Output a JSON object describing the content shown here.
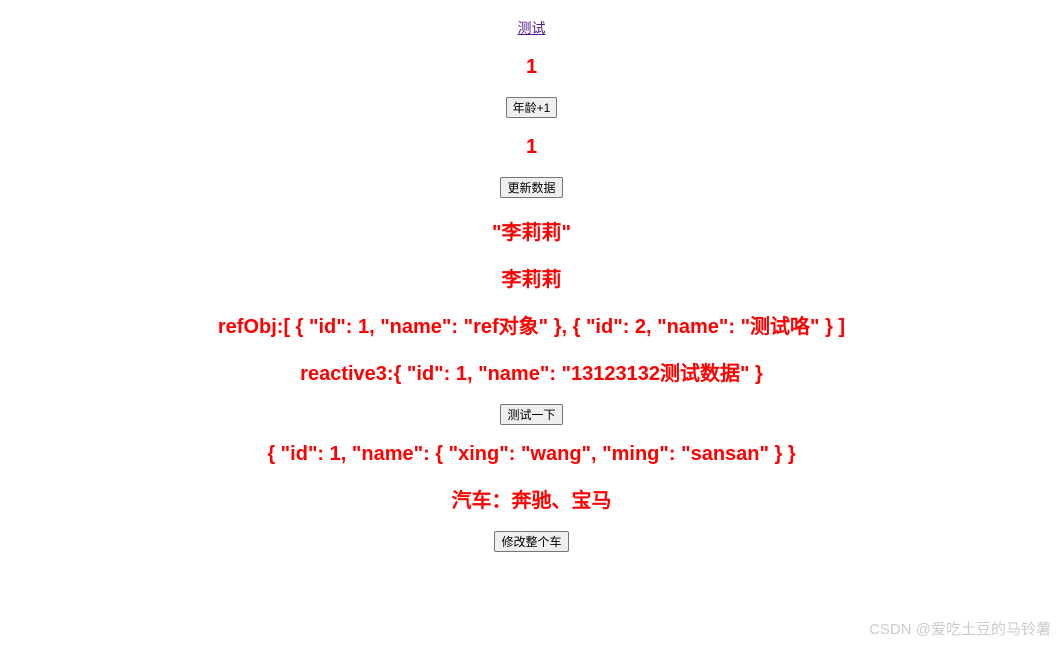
{
  "link": {
    "label": "测试"
  },
  "counter1": {
    "value": "1"
  },
  "buttons": {
    "age_plus": "年龄+1",
    "update_data": "更新数据",
    "test_once": "测试一下",
    "modify_car": "修改整个车"
  },
  "counter2": {
    "value": "1"
  },
  "name_quoted": "\"李莉莉\"",
  "name_plain": "李莉莉",
  "refObj": {
    "label": "refObj:",
    "json": "[ { \"id\": 1, \"name\": \"ref对象\" }, { \"id\": 2, \"name\": \"测试咯\" } ]"
  },
  "reactive3": {
    "label": "reactive3:",
    "json": "{ \"id\": 1, \"name\": \"13123132测试数据\" }"
  },
  "nested_obj": "{ \"id\": 1, \"name\": { \"xing\": \"wang\", \"ming\": \"sansan\" } }",
  "car": {
    "label": "汽车：",
    "value": "奔驰、宝马"
  },
  "watermark": "CSDN @爱吃土豆的马铃薯"
}
